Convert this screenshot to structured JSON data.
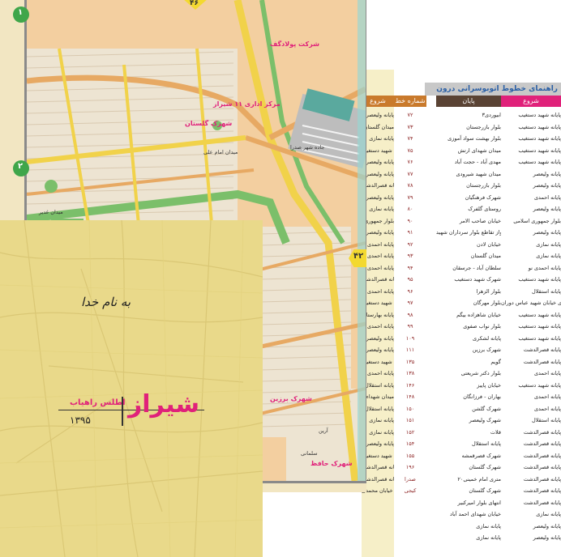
{
  "cover": {
    "bismillah": "به نام خدا",
    "city": "شیراز",
    "publisher": "اطلس راهیاب",
    "year": "۱۳۹۵"
  },
  "map": {
    "page_marker_right": "۴۲",
    "page_marker_top": "۴۶",
    "grid_marker_left_top": "۱",
    "grid_marker_left_mid": "۲",
    "labels": {
      "golestan": "شهرک گلستان",
      "polad": "شرکت پولادگف",
      "barzin": "شهرک برزین",
      "hafez": "شهرک حافظ",
      "center11": "مرکز اداری ۱۱ شیراز",
      "square_alley": "میدان امام علی",
      "sadra_road": "جاده شهر صدرا",
      "ghadir": "میدان غدیر",
      "aryan": "آرین",
      "salmani": "سلمانی"
    }
  },
  "routes": {
    "title": "راهنمای خطوط اتوبوسرانی درون شهری",
    "headers": {
      "start": "شروع",
      "end": "پایان",
      "line": "شماره خط"
    },
    "colors": {
      "start": "#e0217a",
      "end": "#5a4334",
      "line": "#c97a2c"
    },
    "rows": [
      [
        "پایانه شهید دستغیب",
        "ابیوردی۳",
        "۷۲",
        "پایانه ولیعصر"
      ],
      [
        "پایانه شهید دستغیب",
        "بلوار بازرجستان",
        "۷۳",
        "میدان گلستان"
      ],
      [
        "پایانه شهید دستغیب",
        "بلوار بهشت سواد آموزی",
        "۷۴",
        "پایانه نمازی"
      ],
      [
        "پایانه شهید دستغیب",
        "میدان شهدای ارتش",
        "۷۵",
        "پایانه شهید دستغیب"
      ],
      [
        "پایانه شهید دستغیب",
        "مهدی آباد - حجت آباد",
        "۷۶",
        "پایانه ولیعصر"
      ],
      [
        "پایانه ولیعصر",
        "میدان شهید شیرودی",
        "۷۷",
        "پایانه ولیعصر"
      ],
      [
        "پایانه ولیعصر",
        "بلوار بازرجستان",
        "۷۸",
        "پایانه قصرالدشت"
      ],
      [
        "پایانه احمدی",
        "شهرک فرهنگیان",
        "۷۹",
        "پایانه ولیعصر"
      ],
      [
        "پایانه ولیعصر",
        "روستای گلفرک",
        "۸۰",
        "پایانه نمازی"
      ],
      [
        "بلوار جمهوری اسلامی",
        "خیابان صاحب الامر",
        "۹۰",
        "بلوار جمهوری"
      ],
      [
        "پایانه ولیعصر",
        "شهرک پرواز تقاطع بلوار سرداران شهید",
        "۹۱",
        "پایانه ولیعصر"
      ],
      [
        "پایانه نمازی",
        "خیابان لادن",
        "۹۲",
        "پایانه احمدی"
      ],
      [
        "پایانه نمازی",
        "میدان گلستان",
        "۹۳",
        "پایانه احمدی"
      ],
      [
        "پایانه احمدی نو",
        "سلطان آباد - جرسقان",
        "۹۴",
        "پایانه احمدی"
      ],
      [
        "پایانه شهید دستغیب",
        "شهرک شهید دستغیب",
        "۹۵",
        "پایانه قصرالدشت"
      ],
      [
        "پایانه استقلال",
        "بلوار الزهرا",
        "۹۶",
        "پایانه احمدی"
      ],
      [
        "ابتدای خیابان شهید عباس دوران",
        "بلوار مهرگان",
        "۹۷",
        "پایانه شهید دستغیب"
      ],
      [
        "پایانه شهید دستغیب",
        "خیابان شاهزاده بیگم",
        "۹۸",
        "پایانه بهارستان"
      ],
      [
        "پایانه شهید دستغیب",
        "بلوار نواب صفوی",
        "۹۹",
        "پایانه احمدی"
      ],
      [
        "پایانه شهید دستغیب",
        "پایانه لشکری",
        "۱۰۹",
        "پایانه ولیعصر"
      ],
      [
        "پایانه قصرالدشت",
        "شهرک برزین",
        "۱۱۱",
        "پایانه ولیعصر"
      ],
      [
        "پایانه قصرالدشت",
        "گویم",
        "۱۳۵",
        "پایانه شهید دستغیب"
      ],
      [
        "پایانه احمدی",
        "بلوار دکتر شریعتی",
        "۱۳۸",
        "پایانه احمدی"
      ],
      [
        "پایانه شهید دستغیب",
        "خیابان پاییز",
        "۱۴۶",
        "پایانه استقلال"
      ],
      [
        "پایانه احمدی",
        "بهاران - فرزانگان",
        "۱۴۸",
        "میدان شهداء"
      ],
      [
        "پایانه احمدی",
        "شهرک گلشن",
        "۱۵۰",
        "پایانه استقلال"
      ],
      [
        "پایانه استقلال",
        "شهرک ولیعصر",
        "۱۵۱",
        "پایانه نمازی"
      ],
      [
        "پایانه قصرالدشت",
        "قلات",
        "۱۵۲",
        "پایانه نمازی"
      ],
      [
        "پایانه قصرالدشت",
        "پایانه استقلال",
        "۱۵۴",
        "پایانه ولیعصر"
      ],
      [
        "پایانه قصرالدشت",
        "شهرک قصرقمشه",
        "۱۵۵",
        "پایانه شهید دستغیب"
      ],
      [
        "پایانه قصرالدشت",
        "شهرک گلستان",
        "۱۹۶",
        "پایانه قصرالدشت"
      ],
      [
        "پایانه قصرالدشت",
        "۲۰متری امام خمینی",
        "صدرا",
        "پایانه قصرالدشت"
      ],
      [
        "پایانه قصرالدشت",
        "شهرک گلستان",
        "کیجی",
        "آخر خیابان محمدی"
      ],
      [
        "پایانه قصرالدشت",
        "انتهای بلوار امیرکبیر",
        "",
        ""
      ],
      [
        "پایانه نمازی",
        "خیابان شهدای احمد آباد",
        "",
        ""
      ],
      [
        "پایانه ولیعصر",
        "پایانه نمازی",
        "",
        ""
      ],
      [
        "پایانه ولیعصر",
        "پایانه نمازی",
        "",
        ""
      ]
    ]
  }
}
